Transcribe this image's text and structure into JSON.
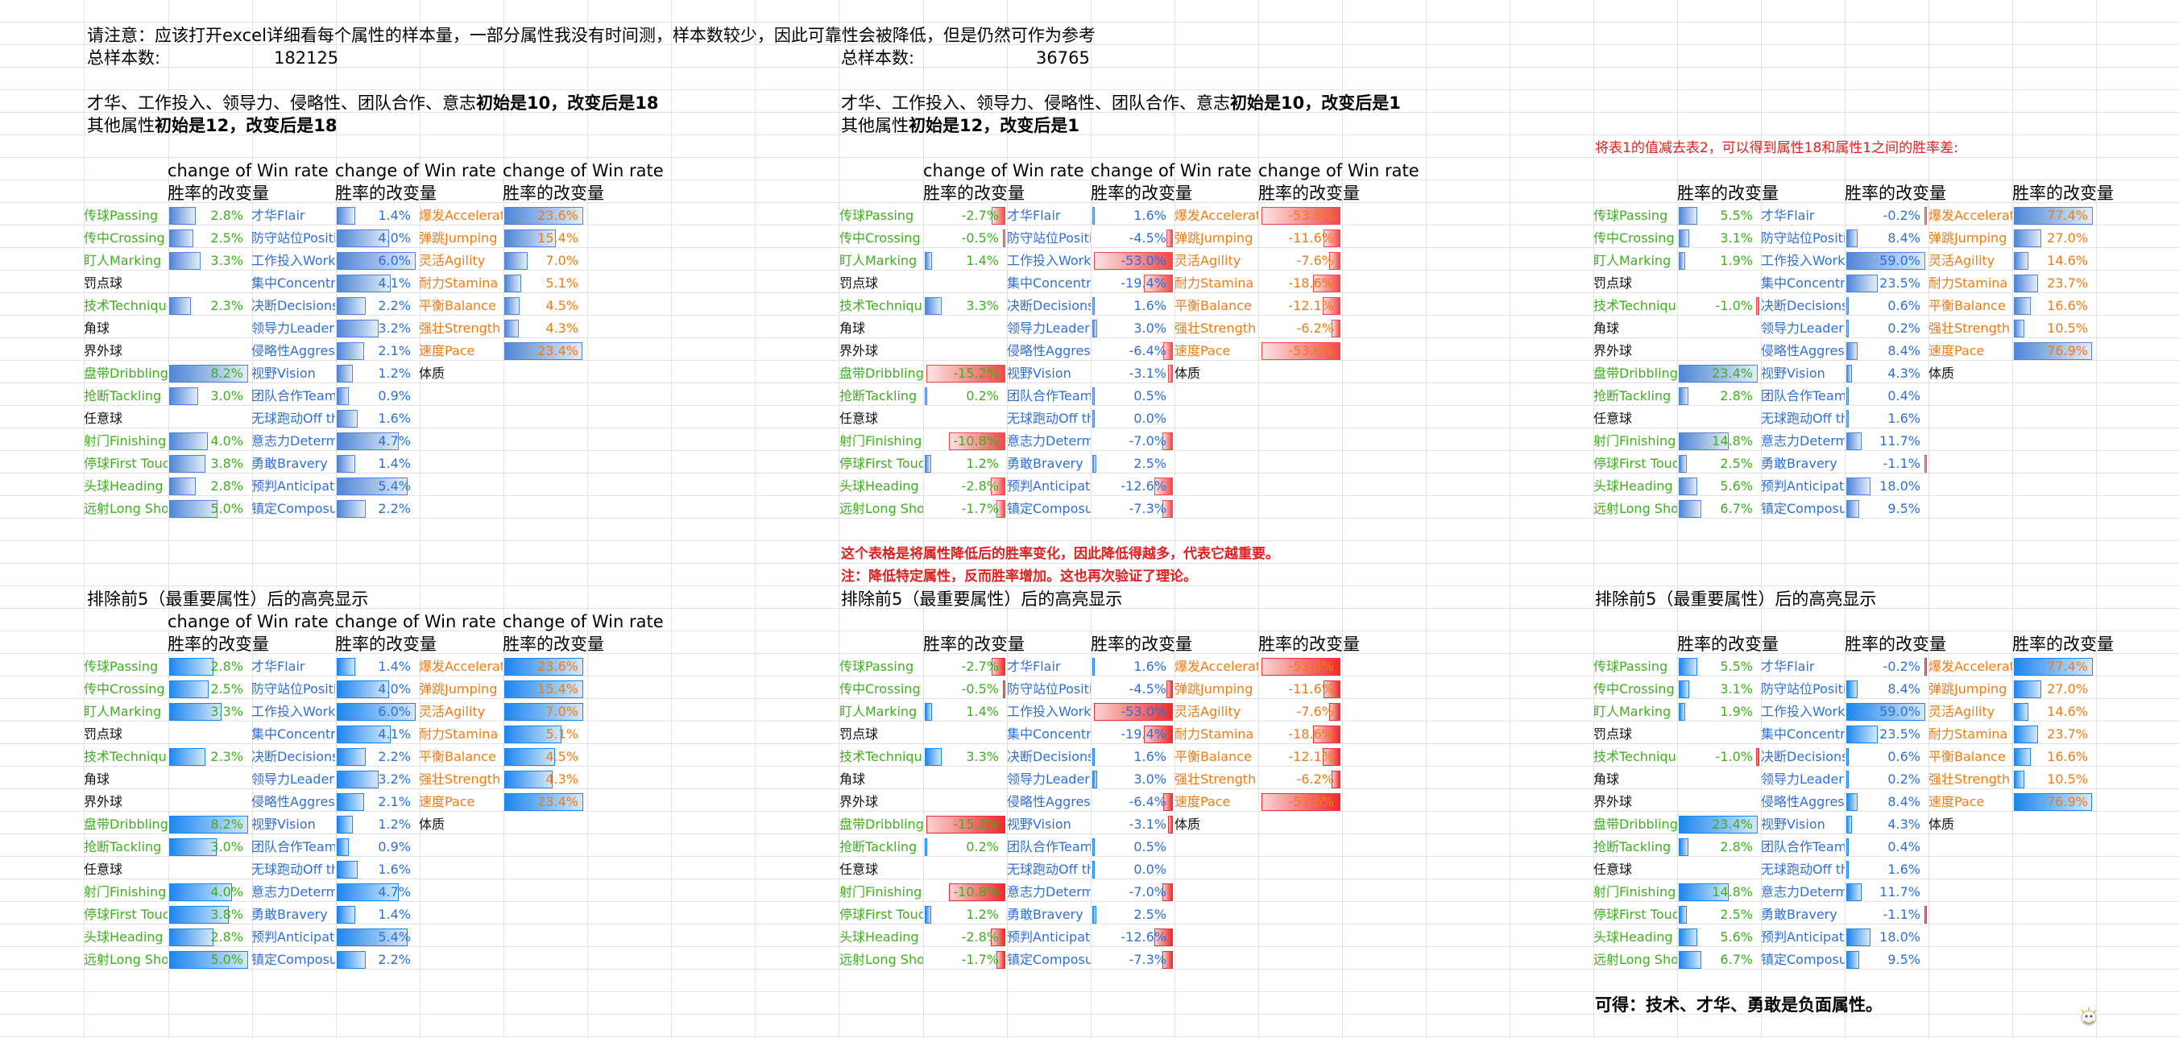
{
  "header": {
    "note": "请注意：应该打开excel详细看每个属性的样本量，一部分属性我没有时间测，样本数较少，因此可靠性会被降低，但是仍然可作为参考",
    "total_label": "总样本数:",
    "total_left": "182125",
    "total_mid": "36765"
  },
  "notes": {
    "l_line1_a": "才华、工作投入、领导力、侵略性、团队合作、意志",
    "l_line1_b": "初始是10，改变后是18",
    "l_line2_a": "其他属性",
    "l_line2_b": "初始是12，改变后是18",
    "m_line1_a": "才华、工作投入、领导力、侵略性、团队合作、意志",
    "m_line1_b": "初始是10，改变后是1",
    "m_line2_a": "其他属性",
    "m_line2_b": "初始是12，改变后是1",
    "r_note": "将表1的值减去表2，可以得到属性18和属性1之间的胜率差:",
    "m_explain1": "这个表格是将属性降低后的胜率变化，因此降低得越多，代表它越重要。",
    "m_explain2": "注：降低特定属性，反而胜率增加。这也再次验证了理论。",
    "highlight_title": "排除前5（最重要属性）后的高亮显示",
    "conclusion": "可得：技术、才华、勇敢是负面属性。"
  },
  "col_header": {
    "win_en": "change of Win rate",
    "win_cn": "胜率的改变量"
  },
  "tech_names": [
    "传球Passing",
    "传中Crossing",
    "盯人Marking",
    "罚点球",
    "技术Technique",
    "角球",
    "界外球",
    "盘带Dribbling",
    "抢断Tackling",
    "任意球",
    "射门Finishing",
    "停球First Touch",
    "头球Heading",
    "远射Long Shots"
  ],
  "tech_colors": [
    "green",
    "green",
    "green",
    "black",
    "green",
    "black",
    "black",
    "green",
    "green",
    "black",
    "green",
    "green",
    "green",
    "green"
  ],
  "mental_names": [
    "才华Flair",
    "防守站位Positioning",
    "工作投入Work Rate",
    "集中Concentration",
    "决断Decisions",
    "领导力Leadership",
    "侵略性Aggression",
    "视野Vision",
    "团队合作Teamwork",
    "无球跑动Off the Ball",
    "意志力Determination",
    "勇敢Bravery",
    "预判Anticipation",
    "镇定Composure"
  ],
  "phys_names": [
    "爆发Acceleration",
    "弹跳Jumping",
    "灵活Agility",
    "耐力Stamina",
    "平衡Balance",
    "强壮Strength",
    "速度Pace",
    "体质"
  ],
  "phys_colors": [
    "orange",
    "orange",
    "orange",
    "orange",
    "orange",
    "orange",
    "orange",
    "black"
  ],
  "colors": {
    "blue_bar": "#4f86d6",
    "red_bar": "#f24a4a",
    "green_text": "#3fae1f",
    "blue_text": "#2f6fd8",
    "orange_text": "#f07b16",
    "note_red": "#e02020"
  },
  "tables": {
    "t1": {
      "tech": [
        "2.8%",
        "2.5%",
        "3.3%",
        "",
        "2.3%",
        "",
        "",
        "8.2%",
        "3.0%",
        "",
        "4.0%",
        "3.8%",
        "2.8%",
        "5.0%"
      ],
      "mental": [
        "1.4%",
        "4.0%",
        "6.0%",
        "4.1%",
        "2.2%",
        "3.2%",
        "2.1%",
        "1.2%",
        "0.9%",
        "1.6%",
        "4.7%",
        "1.4%",
        "5.4%",
        "2.2%"
      ],
      "phys": [
        "23.6%",
        "15.4%",
        "7.0%",
        "5.1%",
        "4.5%",
        "4.3%",
        "23.4%",
        ""
      ]
    },
    "t2": {
      "tech": [
        "-2.7%",
        "-0.5%",
        "1.4%",
        "",
        "3.3%",
        "",
        "",
        "-15.2%",
        "0.2%",
        "",
        "-10.8%",
        "1.2%",
        "-2.8%",
        "-1.7%"
      ],
      "mental": [
        "1.6%",
        "-4.5%",
        "-53.0%",
        "-19.4%",
        "1.6%",
        "3.0%",
        "-6.4%",
        "-3.1%",
        "0.5%",
        "0.0%",
        "-7.0%",
        "2.5%",
        "-12.6%",
        "-7.3%"
      ],
      "phys": [
        "-53.8%",
        "-11.6%",
        "-7.6%",
        "-18.6%",
        "-12.1%",
        "-6.2%",
        "-53.6%",
        ""
      ]
    },
    "t3": {
      "tech": [
        "5.5%",
        "3.1%",
        "1.9%",
        "",
        "-1.0%",
        "",
        "",
        "23.4%",
        "2.8%",
        "",
        "14.8%",
        "2.5%",
        "5.6%",
        "6.7%"
      ],
      "mental": [
        "-0.2%",
        "8.4%",
        "59.0%",
        "23.5%",
        "0.6%",
        "0.2%",
        "8.4%",
        "4.3%",
        "0.4%",
        "1.6%",
        "11.7%",
        "-1.1%",
        "18.0%",
        "9.5%"
      ],
      "phys": [
        "77.4%",
        "27.0%",
        "14.6%",
        "23.7%",
        "16.6%",
        "10.5%",
        "76.9%",
        ""
      ]
    }
  },
  "visible_values": {
    "t2_top": {
      "tech": [
        "-2.7%",
        "-0.5%",
        "1.4%",
        "",
        "3.3%",
        "",
        "",
        "-15.2%",
        "0.2%",
        "",
        "-10.8%",
        "1.2%",
        "-2.8%",
        "-1.7%"
      ],
      "mental": [
        "1.6%",
        "-4.5%",
        "-53.0%",
        "-19.4%",
        "1.6%",
        "3.0%",
        "-6.4%",
        "-3.1%",
        "0.5%",
        "0.0%",
        "-7.0%",
        "2.5%",
        "-12.6%",
        "-7.3%"
      ],
      "phys": [
        "-3.8%",
        "-11.",
        "-7.",
        "-18.",
        "-12.",
        "-6.2",
        "-53.6",
        ""
      ]
    }
  }
}
